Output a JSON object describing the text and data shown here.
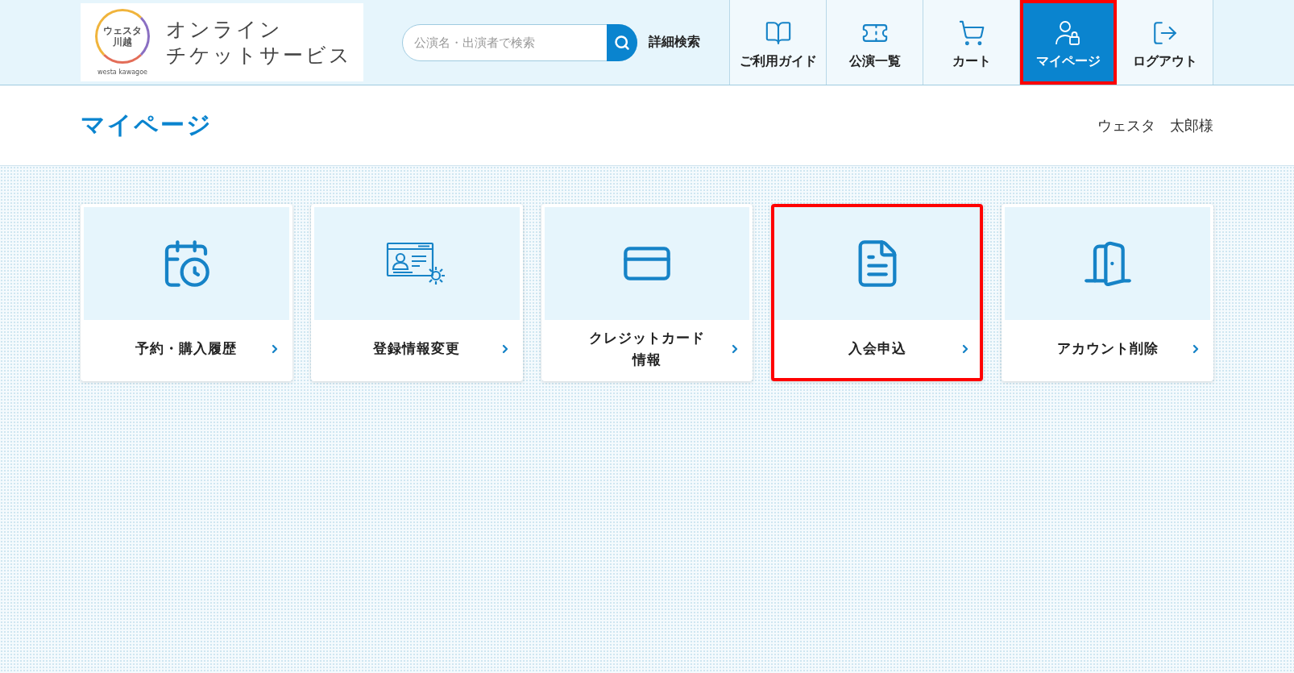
{
  "header": {
    "logo": {
      "mark_text": "ウェスタ川越",
      "mark_subtext": "westa kawagoe",
      "title_lines": [
        "オンライン",
        "チケットサービス"
      ]
    },
    "search": {
      "placeholder": "公演名・出演者で検索",
      "advanced_link": "詳細検索"
    },
    "nav": [
      {
        "label": "ご利用ガイド",
        "selected": false,
        "highlighted": false
      },
      {
        "label": "公演一覧",
        "selected": false,
        "highlighted": false
      },
      {
        "label": "カート",
        "selected": false,
        "highlighted": false
      },
      {
        "label": "マイページ",
        "selected": true,
        "highlighted": true
      },
      {
        "label": "ログアウト",
        "selected": false,
        "highlighted": false
      }
    ]
  },
  "page": {
    "title": "マイページ",
    "user_name": "ウェスタ　太郎様"
  },
  "menu_cards": [
    {
      "label": "予約・購入履歴",
      "highlighted": false
    },
    {
      "label": "登録情報変更",
      "highlighted": false
    },
    {
      "label_lines": [
        "クレジットカード",
        "情報"
      ],
      "highlighted": false
    },
    {
      "label": "入会申込",
      "highlighted": true
    },
    {
      "label": "アカウント削除",
      "highlighted": false
    }
  ]
}
